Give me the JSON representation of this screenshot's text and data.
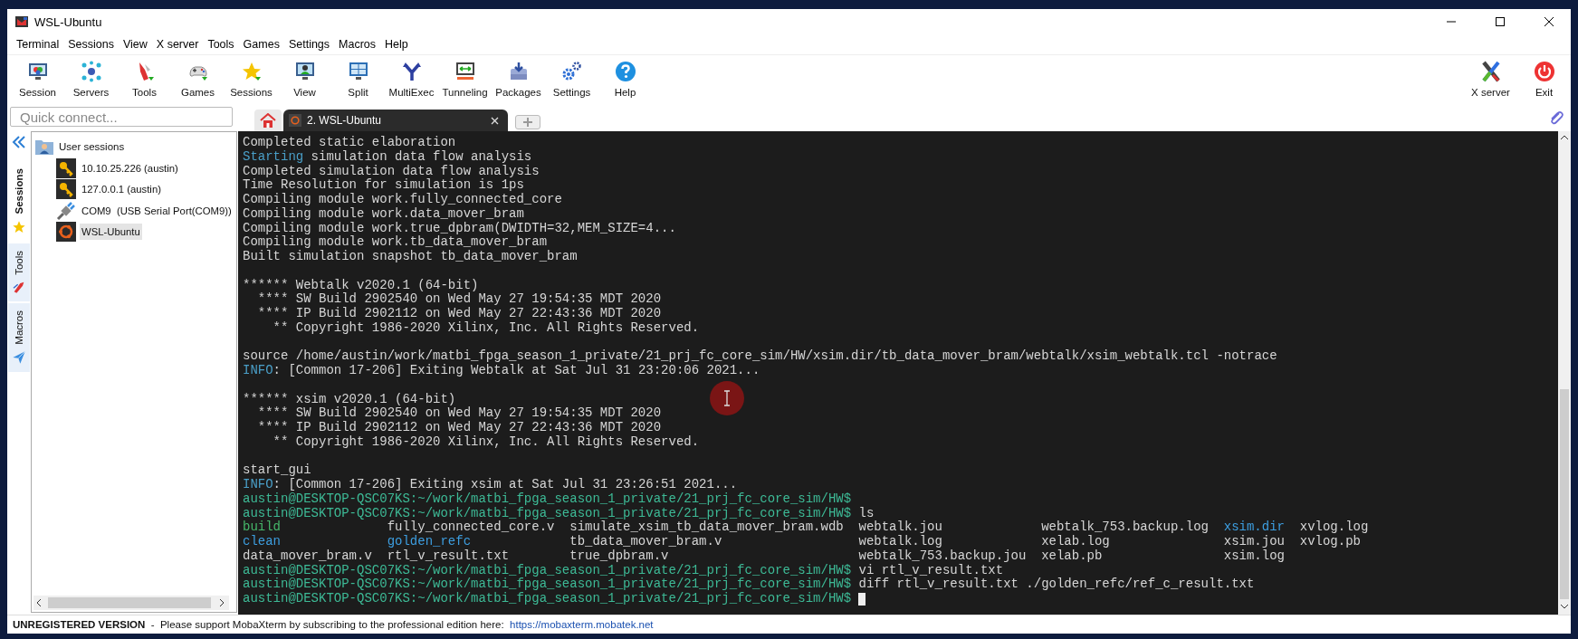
{
  "window": {
    "title": "WSL-Ubuntu"
  },
  "menu": [
    "Terminal",
    "Sessions",
    "View",
    "X server",
    "Tools",
    "Games",
    "Settings",
    "Macros",
    "Help"
  ],
  "toolbar": [
    "Session",
    "Servers",
    "Tools",
    "Games",
    "Sessions",
    "View",
    "Split",
    "MultiExec",
    "Tunneling",
    "Packages",
    "Settings",
    "Help"
  ],
  "toolbar_right": [
    "X server",
    "Exit"
  ],
  "quick_connect": {
    "placeholder": "Quick connect..."
  },
  "tabs": [
    {
      "label": "2. WSL-Ubuntu",
      "selected": true
    }
  ],
  "side_tabs": [
    {
      "label": "Sessions",
      "selected": true
    },
    {
      "label": "Tools",
      "selected": false
    },
    {
      "label": "Macros",
      "selected": false
    }
  ],
  "sessions": {
    "label": "User sessions",
    "children": [
      {
        "label": "10.10.25.226 (austin)",
        "kind": "ssh",
        "selected": false
      },
      {
        "label": "127.0.0.1 (austin)",
        "kind": "ssh",
        "selected": false
      },
      {
        "label": "COM9  (USB Serial Port(COM9))",
        "kind": "serial",
        "selected": false
      },
      {
        "label": "WSL-Ubuntu",
        "kind": "wsl",
        "selected": true
      }
    ]
  },
  "terminal": {
    "blocks": [
      [
        {
          "kind": "text",
          "segments": [
            {
              "kind": "plain",
              "text": "Completed static elaboration"
            }
          ]
        },
        {
          "kind": "text",
          "segments": [
            {
              "kind": "info",
              "text": "Starting"
            },
            {
              "kind": "plain",
              "text": " simulation data flow analysis"
            }
          ]
        },
        {
          "kind": "text",
          "segments": [
            {
              "kind": "plain",
              "text": "Completed simulation data flow analysis"
            }
          ]
        },
        {
          "kind": "text",
          "segments": [
            {
              "kind": "plain",
              "text": "Time Resolution for simulation is 1ps"
            }
          ]
        },
        {
          "kind": "text",
          "segments": [
            {
              "kind": "plain",
              "text": "Compiling module work.fully_connected_core"
            }
          ]
        },
        {
          "kind": "text",
          "segments": [
            {
              "kind": "plain",
              "text": "Compiling module work.data_mover_bram"
            }
          ]
        },
        {
          "kind": "text",
          "segments": [
            {
              "kind": "plain",
              "text": "Compiling module work.true_dpbram(DWIDTH=32,MEM_SIZE=4..."
            }
          ]
        },
        {
          "kind": "text",
          "segments": [
            {
              "kind": "plain",
              "text": "Compiling module work.tb_data_mover_bram"
            }
          ]
        },
        {
          "kind": "text",
          "segments": [
            {
              "kind": "plain",
              "text": "Built simulation snapshot tb_data_mover_bram"
            }
          ]
        }
      ],
      [
        {
          "kind": "text",
          "segments": [
            {
              "kind": "plain",
              "text": "****** Webtalk v2020.1 (64-bit)"
            }
          ]
        },
        {
          "kind": "text",
          "segments": [
            {
              "kind": "plain",
              "text": "  **** SW Build 2902540 on Wed May 27 19:54:35 MDT 2020"
            }
          ]
        },
        {
          "kind": "text",
          "segments": [
            {
              "kind": "plain",
              "text": "  **** IP Build 2902112 on Wed May 27 22:43:36 MDT 2020"
            }
          ]
        },
        {
          "kind": "text",
          "segments": [
            {
              "kind": "plain",
              "text": "    ** Copyright 1986-2020 Xilinx, Inc. All Rights Reserved."
            }
          ]
        }
      ],
      [
        {
          "kind": "text",
          "segments": [
            {
              "kind": "plain",
              "text": "source /home/austin/work/matbi_fpga_season_1_private/21_prj_fc_core_sim/HW/xsim.dir/tb_data_mover_bram/webtalk/xsim_webtalk.tcl -notrace"
            }
          ]
        },
        {
          "kind": "text",
          "segments": [
            {
              "kind": "info",
              "text": "INFO"
            },
            {
              "kind": "plain",
              "text": ": [Common 17-206] Exiting Webtalk at Sat Jul 31 23:20:06 2021..."
            }
          ]
        }
      ],
      [
        {
          "kind": "text",
          "segments": [
            {
              "kind": "plain",
              "text": "****** xsim v2020.1 (64-bit)"
            }
          ]
        },
        {
          "kind": "text",
          "segments": [
            {
              "kind": "plain",
              "text": "  **** SW Build 2902540 on Wed May 27 19:54:35 MDT 2020"
            }
          ]
        },
        {
          "kind": "text",
          "segments": [
            {
              "kind": "plain",
              "text": "  **** IP Build 2902112 on Wed May 27 22:43:36 MDT 2020"
            }
          ]
        },
        {
          "kind": "text",
          "segments": [
            {
              "kind": "plain",
              "text": "    ** Copyright 1986-2020 Xilinx, Inc. All Rights Reserved."
            }
          ]
        }
      ],
      [
        {
          "kind": "text",
          "segments": [
            {
              "kind": "plain",
              "text": "start_gui"
            }
          ]
        },
        {
          "kind": "text",
          "segments": [
            {
              "kind": "info",
              "text": "INFO"
            },
            {
              "kind": "plain",
              "text": ": [Common 17-206] Exiting xsim at Sat Jul 31 23:26:51 2021..."
            }
          ]
        },
        {
          "kind": "text",
          "segments": [
            {
              "kind": "prompt",
              "text": "austin@DESKTOP-QSC07KS:~/work/matbi_fpga_season_1_private/21_prj_fc_core_sim/HW$"
            }
          ]
        },
        {
          "kind": "text",
          "segments": [
            {
              "kind": "prompt",
              "text": "austin@DESKTOP-QSC07KS:~/work/matbi_fpga_season_1_private/21_prj_fc_core_sim/HW$"
            },
            {
              "kind": "plain",
              "text": " ls"
            }
          ]
        },
        {
          "kind": "ls",
          "rows": [
            [
              {
                "kind": "exec",
                "text": "build"
              },
              {
                "kind": "plain",
                "text": "fully_connected_core.v"
              },
              {
                "kind": "plain",
                "text": "simulate_xsim_tb_data_mover_bram.wdb"
              },
              {
                "kind": "plain",
                "text": "webtalk.jou"
              },
              {
                "kind": "plain",
                "text": "webtalk_753.backup.log"
              },
              {
                "kind": "dir",
                "text": "xsim.dir"
              },
              {
                "kind": "plain",
                "text": "xvlog.log"
              }
            ],
            [
              {
                "kind": "dir",
                "text": "clean"
              },
              {
                "kind": "dir",
                "text": "golden_refc"
              },
              {
                "kind": "plain",
                "text": "tb_data_mover_bram.v"
              },
              {
                "kind": "plain",
                "text": "webtalk.log"
              },
              {
                "kind": "plain",
                "text": "xelab.log"
              },
              {
                "kind": "plain",
                "text": "xsim.jou"
              },
              {
                "kind": "plain",
                "text": "xvlog.pb"
              }
            ],
            [
              {
                "kind": "plain",
                "text": "data_mover_bram.v"
              },
              {
                "kind": "plain",
                "text": "rtl_v_result.txt"
              },
              {
                "kind": "plain",
                "text": "true_dpbram.v"
              },
              {
                "kind": "plain",
                "text": "webtalk_753.backup.jou"
              },
              {
                "kind": "plain",
                "text": "xelab.pb"
              },
              {
                "kind": "plain",
                "text": "xsim.log"
              }
            ]
          ]
        },
        {
          "kind": "text",
          "segments": [
            {
              "kind": "prompt",
              "text": "austin@DESKTOP-QSC07KS:~/work/matbi_fpga_season_1_private/21_prj_fc_core_sim/HW$"
            },
            {
              "kind": "plain",
              "text": " vi rtl_v_result.txt"
            }
          ]
        },
        {
          "kind": "text",
          "segments": [
            {
              "kind": "prompt",
              "text": "austin@DESKTOP-QSC07KS:~/work/matbi_fpga_season_1_private/21_prj_fc_core_sim/HW$"
            },
            {
              "kind": "plain",
              "text": " diff rtl_v_result.txt ./golden_refc/ref_c_result.txt"
            }
          ]
        },
        {
          "kind": "text",
          "segments": [
            {
              "kind": "prompt",
              "text": "austin@DESKTOP-QSC07KS:~/work/matbi_fpga_season_1_private/21_prj_fc_core_sim/HW$"
            }
          ]
        }
      ]
    ]
  },
  "status_bar": {
    "text": "**UNREGISTERED VERSION**  -  Please support MobaXterm by subscribing to the professional edition here:",
    "link": "https://mobaxterm.mobatek.net"
  }
}
